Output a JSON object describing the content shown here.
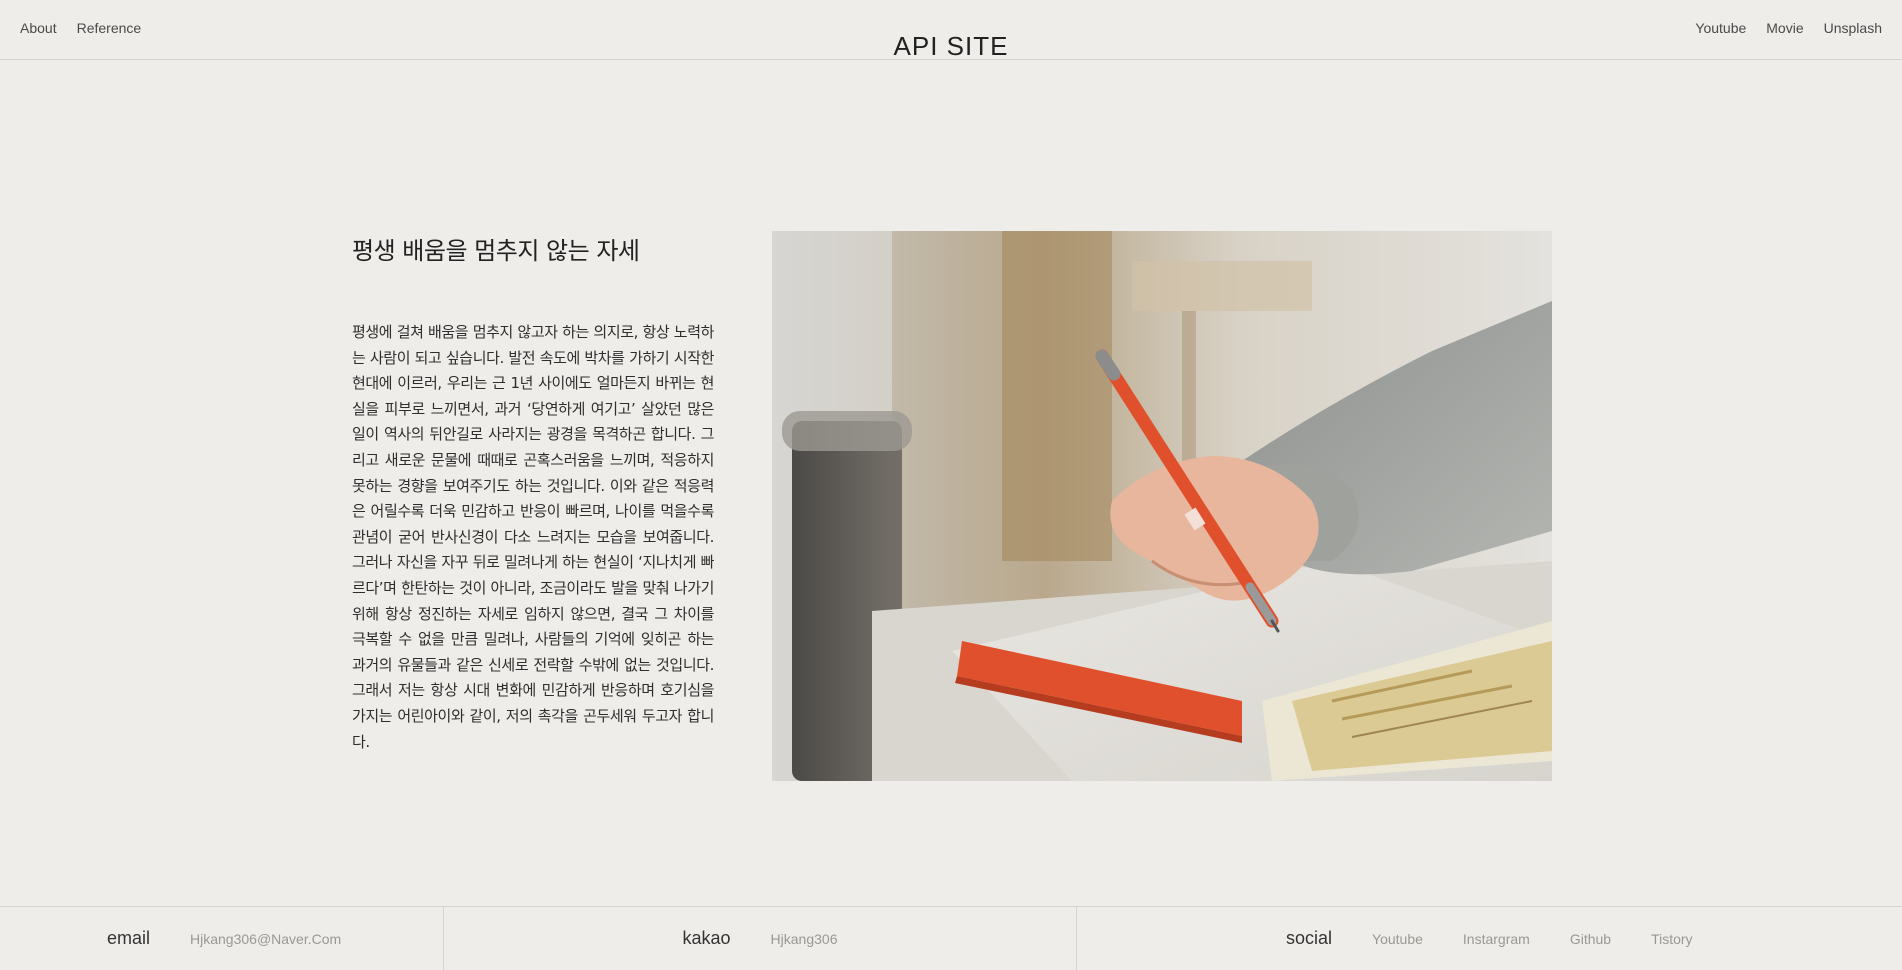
{
  "header": {
    "left_nav": [
      {
        "label": "About"
      },
      {
        "label": "Reference"
      }
    ],
    "title": "API SITE",
    "right_nav": [
      {
        "label": "Youtube"
      },
      {
        "label": "Movie"
      },
      {
        "label": "Unsplash"
      }
    ]
  },
  "main": {
    "title": "평생 배움을 멈추지 않는 자세",
    "body": "평생에 걸쳐 배움을 멈추지 않고자 하는 의지로, 항상 노력하는 사람이 되고 싶습니다. 발전 속도에 박차를 가하기 시작한 현대에 이르러, 우리는 근 1년 사이에도 얼마든지 바뀌는 현실을 피부로 느끼면서, 과거 ‘당연하게 여기고’ 살았던 많은 일이 역사의 뒤안길로 사라지는 광경을 목격하곤 합니다. 그리고 새로운 문물에 때때로 곤혹스러움을 느끼며, 적응하지 못하는 경향을 보여주기도 하는 것입니다. 이와 같은 적응력은 어릴수록 더욱 민감하고 반응이 빠르며, 나이를 먹을수록 관념이 굳어 반사신경이 다소 느려지는 모습을 보여줍니다. 그러나 자신을 자꾸 뒤로 밀려나게 하는 현실이 ‘지나치게 빠르다’며 한탄하는 것이 아니라, 조금이라도 발을 맞춰 나가기 위해 항상 정진하는 자세로 임하지 않으면, 결국 그 차이를 극복할 수 없을 만큼 밀려나, 사람들의 기억에 잊히곤 하는 과거의 유물들과 같은 신세로 전락할 수밖에 없는 것입니다. 그래서 저는 항상 시대 변화에 민감하게 반응하며 호기심을 가지는 어린아이와 같이, 저의 촉각을 곤두세워 두고자 합니다."
  },
  "footer": {
    "email": {
      "label": "email",
      "value": "Hjkang306@Naver.Com"
    },
    "kakao": {
      "label": "kakao",
      "value": "Hjkang306"
    },
    "social": {
      "label": "social",
      "links": [
        {
          "label": "Youtube"
        },
        {
          "label": "Instargram"
        },
        {
          "label": "Github"
        },
        {
          "label": "Tistory"
        }
      ]
    }
  },
  "colors": {
    "background": "#efede9",
    "divider": "#d6d3ce",
    "pen": "#e0502c"
  }
}
